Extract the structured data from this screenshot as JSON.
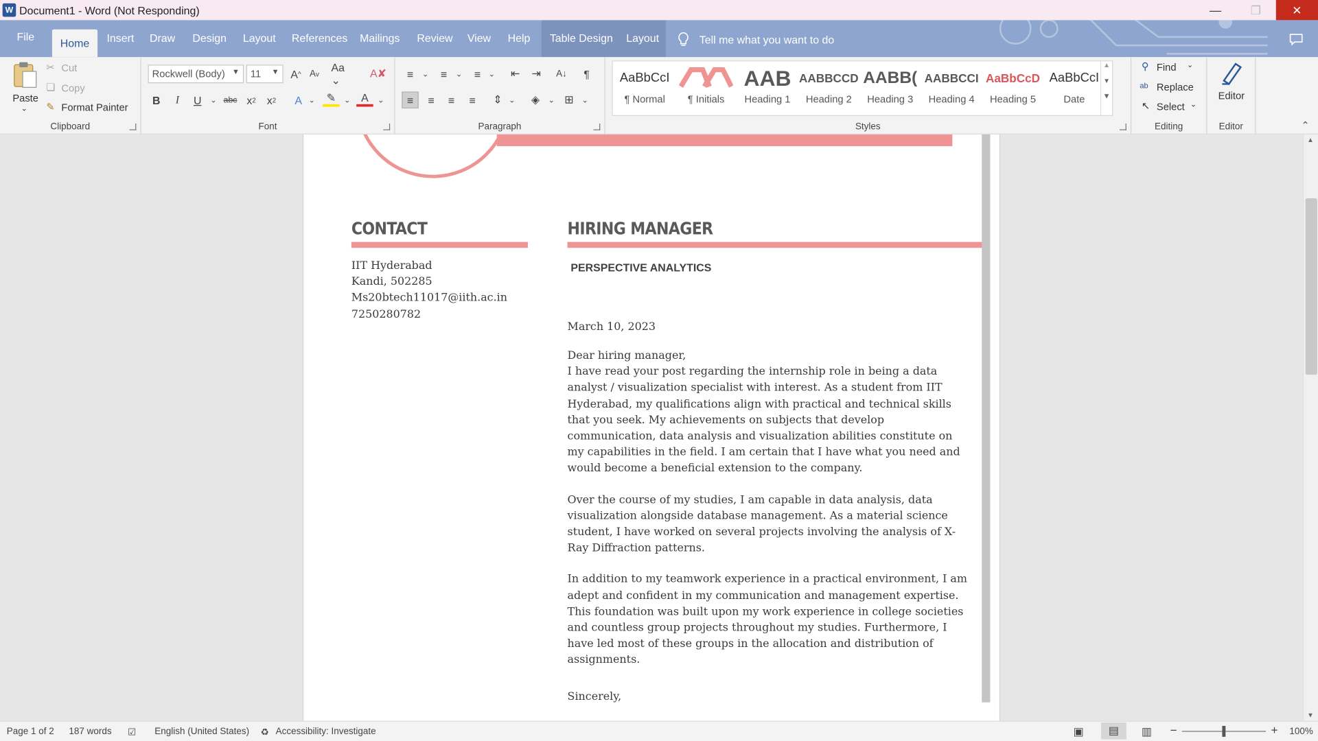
{
  "titlebar": {
    "app_icon": "W",
    "title": "Document1 - Word (Not Responding)"
  },
  "tabs": [
    "File",
    "Home",
    "Insert",
    "Draw",
    "Design",
    "Layout",
    "References",
    "Mailings",
    "Review",
    "View",
    "Help",
    "Table Design",
    "Layout"
  ],
  "tell_me": "Tell me what you want to do",
  "clipboard": {
    "paste": "Paste",
    "cut": "Cut",
    "copy": "Copy",
    "format_painter": "Format Painter",
    "label": "Clipboard"
  },
  "font": {
    "name": "Rockwell (Body)",
    "size": "11",
    "label": "Font"
  },
  "paragraph": {
    "label": "Paragraph"
  },
  "styles": {
    "items": [
      {
        "sample": "AaBbCcI",
        "name": "¶ Normal"
      },
      {
        "sample": "",
        "name": "¶ Initials"
      },
      {
        "sample": "AAB",
        "name": "Heading 1"
      },
      {
        "sample": "AABBCCD",
        "name": "Heading 2"
      },
      {
        "sample": "AABB(",
        "name": "Heading 3"
      },
      {
        "sample": "AABBCCI",
        "name": "Heading 4"
      },
      {
        "sample": "AaBbCcD",
        "name": "Heading 5"
      },
      {
        "sample": "AaBbCcI",
        "name": "Date"
      }
    ],
    "label": "Styles"
  },
  "editing": {
    "find": "Find",
    "replace": "Replace",
    "select": "Select",
    "label": "Editing"
  },
  "editor": {
    "button": "Editor",
    "label": "Editor"
  },
  "document": {
    "contact_heading": "CONTACT",
    "contact_lines": [
      "IIT Hyderabad",
      "Kandi, 502285",
      "Ms20btech11017@iith.ac.in",
      "7250280782"
    ],
    "hm_heading": "HIRING MANAGER",
    "company": "PERSPECTIVE ANALYTICS",
    "date": "March 10, 2023",
    "salutation": "Dear hiring manager,",
    "para1_lines": [
      "I have read your post regarding the internship role in being a data",
      "analyst / visualization specialist with interest. As a student from IIT",
      "Hyderabad, my qualifications align with practical and technical skills",
      "that you seek. My achievements on subjects that develop",
      "communication, data analysis and visualization abilities constitute on",
      "my capabilities in the field. I am certain that I have what you need and",
      "would become a beneficial extension to the company."
    ],
    "para2_lines": [
      "Over the course of my studies, I am capable in data analysis, data",
      "visualization alongside database management.  As a material science",
      "student, I have worked on several projects involving the analysis of X-",
      "Ray Diffraction patterns."
    ],
    "para3_lines": [
      "In addition to my teamwork experience in a practical environment, I am",
      "adept and confident in my communication and management expertise.",
      "This foundation was built upon my work experience in college societies",
      "and countless group projects throughout my studies. Furthermore, I",
      "have led most of these groups in the allocation and distribution of",
      "assignments."
    ],
    "closing": "Sincerely,",
    "accent_color": "#ee9593",
    "heading_color": "#595959"
  },
  "status": {
    "page": "Page 1 of 2",
    "words": "187 words",
    "language": "English (United States)",
    "accessibility": "Accessibility: Investigate",
    "zoom": "100%"
  }
}
